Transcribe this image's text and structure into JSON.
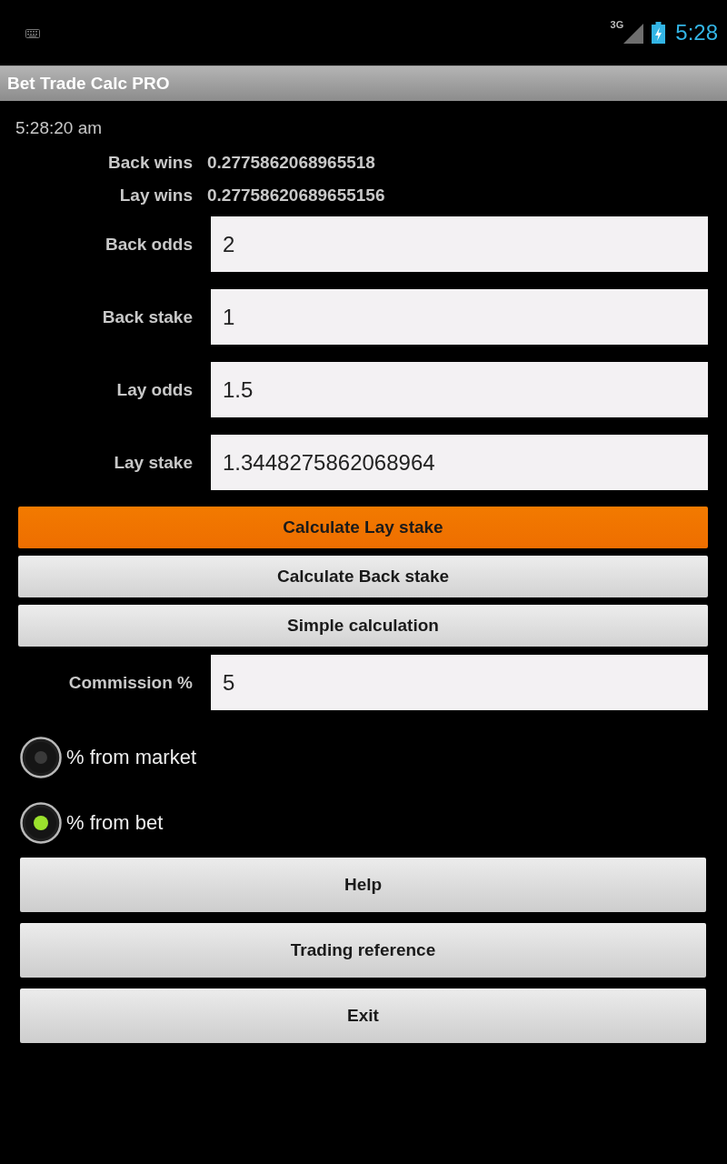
{
  "status_bar": {
    "network": "3G",
    "time": "5:28"
  },
  "app_bar": {
    "title": "Bet Trade Calc PRO"
  },
  "timestamp": "5:28:20 am",
  "results": [
    {
      "label": "Back wins",
      "value": "0.2775862068965518"
    },
    {
      "label": "Lay wins",
      "value": "0.27758620689655156"
    }
  ],
  "fields": [
    {
      "label": "Back odds",
      "value": "2"
    },
    {
      "label": "Back stake",
      "value": "1"
    },
    {
      "label": "Lay odds",
      "value": "1.5"
    },
    {
      "label": "Lay stake",
      "value": "1.3448275862068964"
    }
  ],
  "calc_buttons": [
    {
      "label": "Calculate Lay stake",
      "focused": true
    },
    {
      "label": "Calculate Back stake",
      "focused": false
    },
    {
      "label": "Simple calculation",
      "focused": false
    }
  ],
  "commission": {
    "label": "Commission %",
    "value": "5"
  },
  "commission_modes": [
    {
      "label": "% from market",
      "selected": false
    },
    {
      "label": "% from bet",
      "selected": true
    }
  ],
  "nav_buttons": [
    "Help",
    "Trading reference",
    "Exit"
  ]
}
